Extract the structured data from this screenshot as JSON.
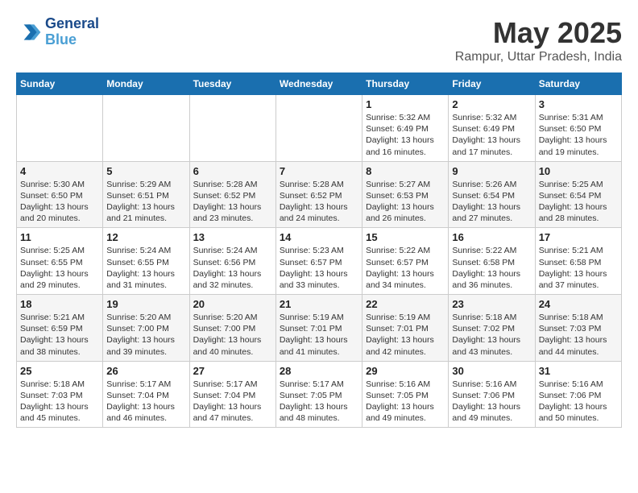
{
  "header": {
    "logo_line1": "General",
    "logo_line2": "Blue",
    "title": "May 2025",
    "subtitle": "Rampur, Uttar Pradesh, India"
  },
  "days_of_week": [
    "Sunday",
    "Monday",
    "Tuesday",
    "Wednesday",
    "Thursday",
    "Friday",
    "Saturday"
  ],
  "weeks": [
    [
      {
        "num": "",
        "info": ""
      },
      {
        "num": "",
        "info": ""
      },
      {
        "num": "",
        "info": ""
      },
      {
        "num": "",
        "info": ""
      },
      {
        "num": "1",
        "info": "Sunrise: 5:32 AM\nSunset: 6:49 PM\nDaylight: 13 hours\nand 16 minutes."
      },
      {
        "num": "2",
        "info": "Sunrise: 5:32 AM\nSunset: 6:49 PM\nDaylight: 13 hours\nand 17 minutes."
      },
      {
        "num": "3",
        "info": "Sunrise: 5:31 AM\nSunset: 6:50 PM\nDaylight: 13 hours\nand 19 minutes."
      }
    ],
    [
      {
        "num": "4",
        "info": "Sunrise: 5:30 AM\nSunset: 6:50 PM\nDaylight: 13 hours\nand 20 minutes."
      },
      {
        "num": "5",
        "info": "Sunrise: 5:29 AM\nSunset: 6:51 PM\nDaylight: 13 hours\nand 21 minutes."
      },
      {
        "num": "6",
        "info": "Sunrise: 5:28 AM\nSunset: 6:52 PM\nDaylight: 13 hours\nand 23 minutes."
      },
      {
        "num": "7",
        "info": "Sunrise: 5:28 AM\nSunset: 6:52 PM\nDaylight: 13 hours\nand 24 minutes."
      },
      {
        "num": "8",
        "info": "Sunrise: 5:27 AM\nSunset: 6:53 PM\nDaylight: 13 hours\nand 26 minutes."
      },
      {
        "num": "9",
        "info": "Sunrise: 5:26 AM\nSunset: 6:54 PM\nDaylight: 13 hours\nand 27 minutes."
      },
      {
        "num": "10",
        "info": "Sunrise: 5:25 AM\nSunset: 6:54 PM\nDaylight: 13 hours\nand 28 minutes."
      }
    ],
    [
      {
        "num": "11",
        "info": "Sunrise: 5:25 AM\nSunset: 6:55 PM\nDaylight: 13 hours\nand 29 minutes."
      },
      {
        "num": "12",
        "info": "Sunrise: 5:24 AM\nSunset: 6:55 PM\nDaylight: 13 hours\nand 31 minutes."
      },
      {
        "num": "13",
        "info": "Sunrise: 5:24 AM\nSunset: 6:56 PM\nDaylight: 13 hours\nand 32 minutes."
      },
      {
        "num": "14",
        "info": "Sunrise: 5:23 AM\nSunset: 6:57 PM\nDaylight: 13 hours\nand 33 minutes."
      },
      {
        "num": "15",
        "info": "Sunrise: 5:22 AM\nSunset: 6:57 PM\nDaylight: 13 hours\nand 34 minutes."
      },
      {
        "num": "16",
        "info": "Sunrise: 5:22 AM\nSunset: 6:58 PM\nDaylight: 13 hours\nand 36 minutes."
      },
      {
        "num": "17",
        "info": "Sunrise: 5:21 AM\nSunset: 6:58 PM\nDaylight: 13 hours\nand 37 minutes."
      }
    ],
    [
      {
        "num": "18",
        "info": "Sunrise: 5:21 AM\nSunset: 6:59 PM\nDaylight: 13 hours\nand 38 minutes."
      },
      {
        "num": "19",
        "info": "Sunrise: 5:20 AM\nSunset: 7:00 PM\nDaylight: 13 hours\nand 39 minutes."
      },
      {
        "num": "20",
        "info": "Sunrise: 5:20 AM\nSunset: 7:00 PM\nDaylight: 13 hours\nand 40 minutes."
      },
      {
        "num": "21",
        "info": "Sunrise: 5:19 AM\nSunset: 7:01 PM\nDaylight: 13 hours\nand 41 minutes."
      },
      {
        "num": "22",
        "info": "Sunrise: 5:19 AM\nSunset: 7:01 PM\nDaylight: 13 hours\nand 42 minutes."
      },
      {
        "num": "23",
        "info": "Sunrise: 5:18 AM\nSunset: 7:02 PM\nDaylight: 13 hours\nand 43 minutes."
      },
      {
        "num": "24",
        "info": "Sunrise: 5:18 AM\nSunset: 7:03 PM\nDaylight: 13 hours\nand 44 minutes."
      }
    ],
    [
      {
        "num": "25",
        "info": "Sunrise: 5:18 AM\nSunset: 7:03 PM\nDaylight: 13 hours\nand 45 minutes."
      },
      {
        "num": "26",
        "info": "Sunrise: 5:17 AM\nSunset: 7:04 PM\nDaylight: 13 hours\nand 46 minutes."
      },
      {
        "num": "27",
        "info": "Sunrise: 5:17 AM\nSunset: 7:04 PM\nDaylight: 13 hours\nand 47 minutes."
      },
      {
        "num": "28",
        "info": "Sunrise: 5:17 AM\nSunset: 7:05 PM\nDaylight: 13 hours\nand 48 minutes."
      },
      {
        "num": "29",
        "info": "Sunrise: 5:16 AM\nSunset: 7:05 PM\nDaylight: 13 hours\nand 49 minutes."
      },
      {
        "num": "30",
        "info": "Sunrise: 5:16 AM\nSunset: 7:06 PM\nDaylight: 13 hours\nand 49 minutes."
      },
      {
        "num": "31",
        "info": "Sunrise: 5:16 AM\nSunset: 7:06 PM\nDaylight: 13 hours\nand 50 minutes."
      }
    ]
  ]
}
